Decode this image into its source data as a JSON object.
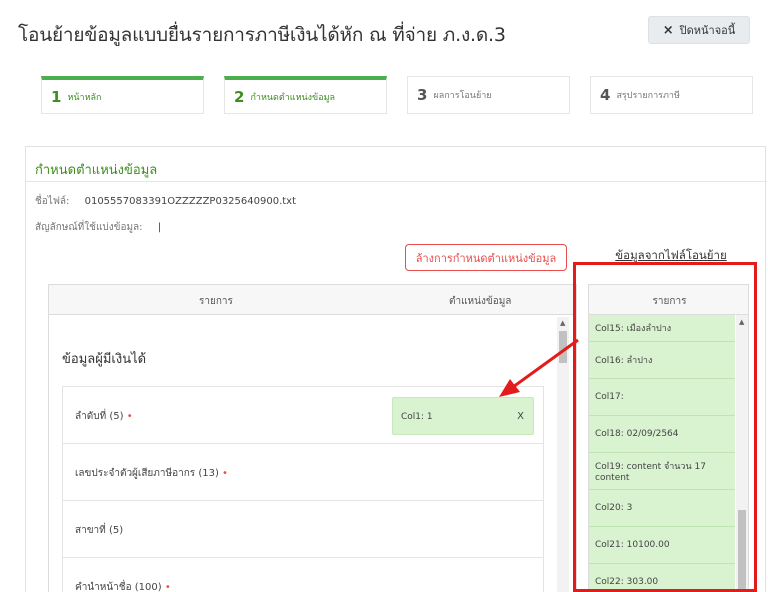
{
  "header": {
    "title": "โอนย้ายข้อมูลแบบยื่นรายการภาษีเงินได้หัก ณ ที่จ่าย ภ.ง.ด.3",
    "close_icon": "×",
    "close_label": "ปิดหน้าจอนี้"
  },
  "steps": [
    {
      "num": "1",
      "label": "หน้าหลัก",
      "active": true
    },
    {
      "num": "2",
      "label": "กำหนดตำแหน่งข้อมูล",
      "active": true
    },
    {
      "num": "3",
      "label": "ผลการโอนย้าย",
      "active": false
    },
    {
      "num": "4",
      "label": "สรุปรายการภาษี",
      "active": false
    }
  ],
  "card": {
    "title": "กำหนดตำแหน่งข้อมูล",
    "file_label": "ชื่อไฟล์:",
    "file_name": "0105557083391OZZZZZP0325640900.txt",
    "delimiter_label": "สัญลักษณ์ที่ใช้แบ่งข้อมูล:",
    "delimiter_value": "|",
    "reset_label": "ล้างการกำหนดตำแหน่งข้อมูล",
    "source_title": "ข้อมูลจากไฟล์โอนย้าย"
  },
  "left_table": {
    "header_item": "รายการ",
    "header_position": "ตำแหน่งข้อมูล",
    "section": "ข้อมูลผู้มีเงินได้",
    "rows": [
      {
        "label": "ลำดับที่ (5)",
        "required": "•",
        "mapped": "Col1: 1",
        "remove": "X"
      },
      {
        "label": "เลขประจำตัวผู้เสียภาษีอากร (13)",
        "required": "•"
      },
      {
        "label": "สาขาที่ (5)",
        "required": ""
      },
      {
        "label": "คำนำหน้าชื่อ (100)",
        "required": "•"
      }
    ]
  },
  "right_table": {
    "header": "รายการ",
    "columns": [
      "Col15: เมืองลำปาง",
      "Col16: ลำปาง",
      "Col17:",
      "Col18: 02/09/2564",
      "Col19: content จำนวน 17 content",
      "Col20: 3",
      "Col21: 10100.00",
      "Col22: 303.00"
    ]
  },
  "annotation_color": "#e41b1b"
}
